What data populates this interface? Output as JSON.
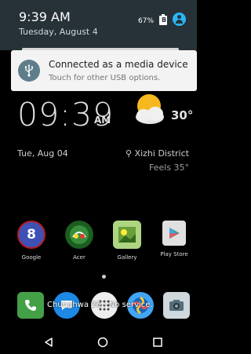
{
  "shade": {
    "time": "9:39 AM",
    "date": "Tuesday, August 4",
    "battery_pct": "67%",
    "battery_glyph": "B"
  },
  "notification": {
    "title": "Connected as a media device",
    "subtitle": "Touch for other USB options.",
    "icon": "usb-icon"
  },
  "clock_widget": {
    "time": "09:39",
    "ampm": "AM",
    "temperature": "30°",
    "date": "Tue, Aug 04",
    "location": "Xizhi District",
    "feels": "Feels 35°"
  },
  "apps": [
    {
      "label": "Google",
      "icon": "google-icon",
      "color": "#3f51b5"
    },
    {
      "label": "Acer",
      "icon": "acer-icon",
      "color": "#2e7d32"
    },
    {
      "label": "Gallery",
      "icon": "gallery-icon",
      "color": "#8bc34a"
    },
    {
      "label": "Play Store",
      "icon": "play-store-icon",
      "color": "#e0e0e0"
    }
  ],
  "dock": {
    "toast": "Chunghwa 26 - No service."
  },
  "colors": {
    "shade": "#263238",
    "accent": "#29b6f6",
    "notification_bg": "#f3f3f3"
  }
}
